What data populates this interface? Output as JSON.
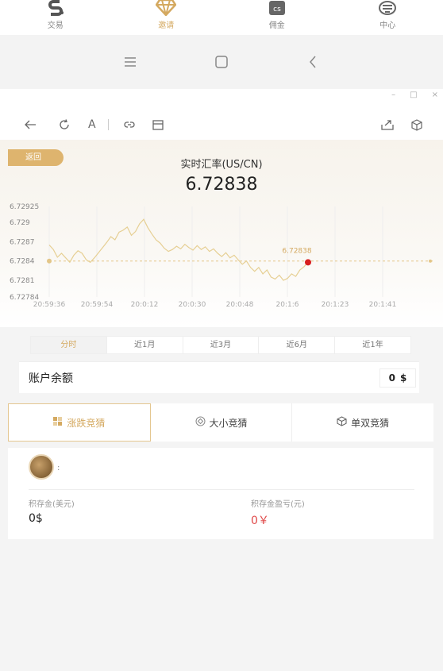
{
  "tabbar": {
    "tabs": [
      {
        "label": "交易",
        "icon": "s-logo-icon",
        "active": false
      },
      {
        "label": "邀请",
        "icon": "diamond-icon",
        "active": true
      },
      {
        "label": "佣金",
        "icon": "lastfm-icon",
        "active": false
      },
      {
        "label": "中心",
        "icon": "stack-icon",
        "active": false
      }
    ]
  },
  "android_nav": {
    "items": [
      "menu-icon",
      "home-icon",
      "back-icon"
    ]
  },
  "window": {
    "controls": [
      "–",
      "□",
      "×"
    ]
  },
  "toolbar": {
    "left": [
      "back-arrow-icon",
      "refresh-icon",
      "font-icon",
      "link-icon",
      "bookmark-icon"
    ],
    "right": [
      "share-icon",
      "package-icon"
    ]
  },
  "rate": {
    "back_label": "返回",
    "title": "实时汇率(US/CN)",
    "value": "6.72838"
  },
  "chart_data": {
    "type": "line",
    "x_ticks": [
      "20:59:36",
      "20:59:54",
      "20:0:12",
      "20:0:30",
      "20:0:48",
      "20:1:6",
      "20:1:23",
      "20:1:41"
    ],
    "y_ticks": [
      "6.72925",
      "6.729",
      "6.7287",
      "6.7284",
      "6.7281",
      "6.72784"
    ],
    "ylim": [
      6.72784,
      6.72925
    ],
    "reference_value": 6.7284,
    "current_label": "6.72838",
    "current_value": 6.72838,
    "series": [
      {
        "values": [
          6.72865,
          6.72858,
          6.72846,
          6.72852,
          6.72845,
          6.72838,
          6.72849,
          6.72856,
          6.72852,
          6.72842,
          6.72838,
          6.72845,
          6.72853,
          6.72861,
          6.72869,
          6.72878,
          6.72873,
          6.72885,
          6.72888,
          6.72893,
          6.7288,
          6.72886,
          6.72898,
          6.72905,
          6.72892,
          6.72882,
          6.72873,
          6.72868,
          6.7286,
          6.72855,
          6.72858,
          6.72863,
          6.72859,
          6.72866,
          6.72861,
          6.72857,
          6.72864,
          6.72858,
          6.72862,
          6.72855,
          6.72859,
          6.72852,
          6.72847,
          6.72853,
          6.72845,
          6.72849,
          6.72842,
          6.72835,
          6.7284,
          6.7283,
          6.72824,
          6.7283,
          6.7282,
          6.72826,
          6.72815,
          6.72812,
          6.72818,
          6.7281,
          6.72813,
          6.7282,
          6.72816,
          6.72826,
          6.72831,
          6.72838
        ]
      }
    ],
    "color": "#e6cf93"
  },
  "periods": [
    "分时",
    "近1月",
    "近3月",
    "近6月",
    "近1年"
  ],
  "balance": {
    "label": "账户余额",
    "value": "0",
    "unit": "$"
  },
  "games": [
    {
      "label": "涨跌竞猜",
      "icon": "squares-icon",
      "active": true
    },
    {
      "label": "大小竞猜",
      "icon": "gem-icon",
      "active": false
    },
    {
      "label": "单双竞猜",
      "icon": "cube-icon",
      "active": false
    }
  ],
  "user": {
    "name": ":",
    "stats": [
      {
        "label": "积存金(美元)",
        "value": "0$"
      },
      {
        "label": "积存金盈亏(元)",
        "value": "0￥"
      }
    ]
  }
}
